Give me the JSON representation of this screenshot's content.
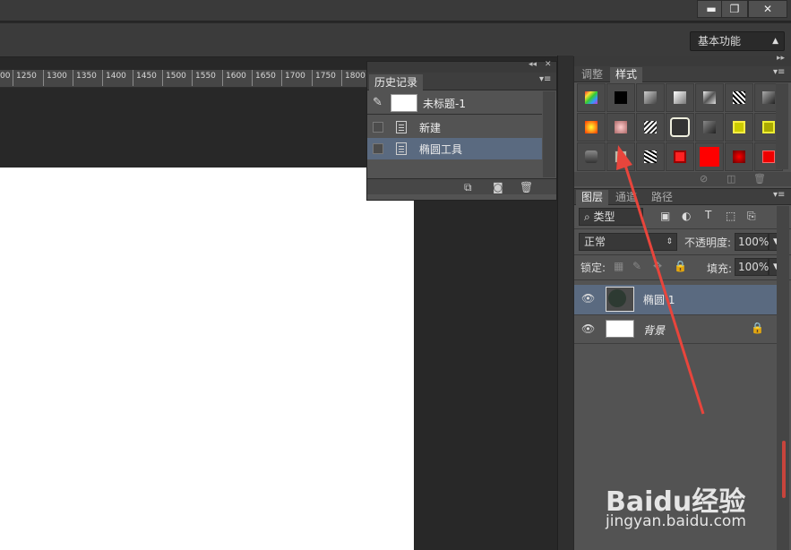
{
  "window": {
    "min_icon": "minimize-icon",
    "restore_icon": "restore-icon",
    "close_icon": "close-icon"
  },
  "workspace": {
    "value": "基本功能"
  },
  "ruler": {
    "ticks": [
      "00",
      "1250",
      "1300",
      "1350",
      "1400",
      "1450",
      "1500",
      "1550",
      "1600",
      "1650",
      "1700",
      "1750",
      "1800"
    ]
  },
  "history": {
    "tab": "历史记录",
    "snapshot_label": "未标题-1",
    "items": [
      {
        "label": "新建"
      },
      {
        "label": "椭圆工具"
      }
    ]
  },
  "styles_panel": {
    "tabs": [
      "调整",
      "样式"
    ]
  },
  "layers_panel": {
    "tabs": [
      "图层",
      "通道",
      "路径"
    ],
    "filter_label": "类型",
    "blend_mode": "正常",
    "opacity_label": "不透明度:",
    "opacity_value": "100%",
    "lock_label": "锁定:",
    "fill_label": "填充:",
    "fill_value": "100%",
    "layers": [
      {
        "name": "椭圆 1"
      },
      {
        "name": "背景"
      }
    ]
  },
  "watermark": {
    "logo": "Baidu经验",
    "url": "jingyan.baidu.com"
  },
  "colors": {
    "accent_arrow": "#e8453c",
    "selected_row": "#5a6a80",
    "panel": "#535353"
  }
}
